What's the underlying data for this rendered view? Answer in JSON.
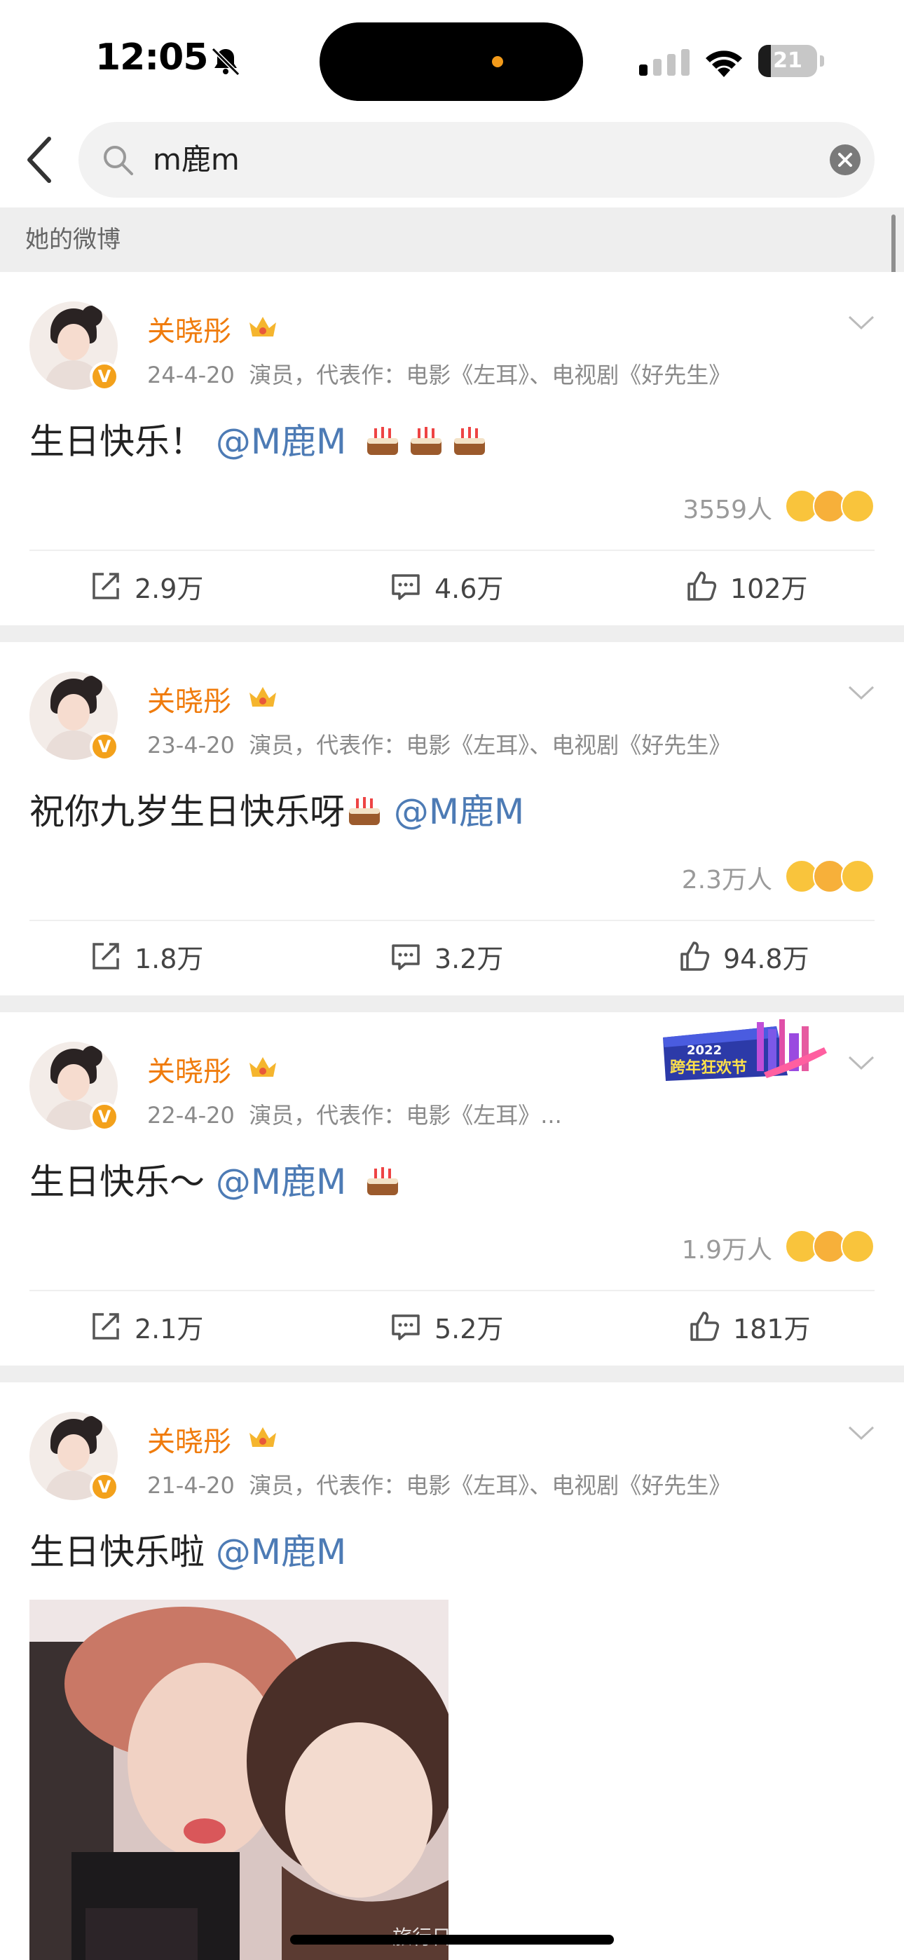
{
  "status_bar": {
    "time": "12:05",
    "battery": "21",
    "battery_level_percent": 21
  },
  "search": {
    "query": "m鹿m"
  },
  "section": {
    "title": "她的微博"
  },
  "posts": [
    {
      "username": "关晓彤",
      "date": "24-4-20",
      "meta": "演员，代表作：电影《左耳》、电视剧《好先生》",
      "text": "生日快乐！",
      "mention": "@M鹿M",
      "cakes_after": 3,
      "reaction_count": "3559人",
      "repost": "2.9万",
      "comments": "4.6万",
      "likes": "102万"
    },
    {
      "username": "关晓彤",
      "date": "23-4-20",
      "meta": "演员，代表作：电影《左耳》、电视剧《好先生》",
      "text": "祝你九岁生日快乐呀",
      "mention": "@M鹿M",
      "cakes_before": 1,
      "reaction_count": "2.3万人",
      "repost": "1.8万",
      "comments": "3.2万",
      "likes": "94.8万"
    },
    {
      "username": "关晓彤",
      "date": "22-4-20",
      "meta": "演员，代表作：电影《左耳》...",
      "text": "生日快乐～",
      "mention": "@M鹿M",
      "cakes_after": 1,
      "reaction_count": "1.9万人",
      "repost": "2.1万",
      "comments": "5.2万",
      "likes": "181万",
      "banner": {
        "year": "2022",
        "text": "跨年狂欢节"
      }
    },
    {
      "username": "关晓彤",
      "date": "21-4-20",
      "meta": "演员，代表作：电影《左耳》、电视剧《好先生》",
      "text": "生日快乐啦",
      "mention": "@M鹿M",
      "has_photo": true
    }
  ],
  "watermark": "旅行日记",
  "colors": {
    "username": "#f07c0d",
    "mention": "#4d7bb5",
    "badge": "#f3a11b",
    "separator": "#eeeeee"
  }
}
